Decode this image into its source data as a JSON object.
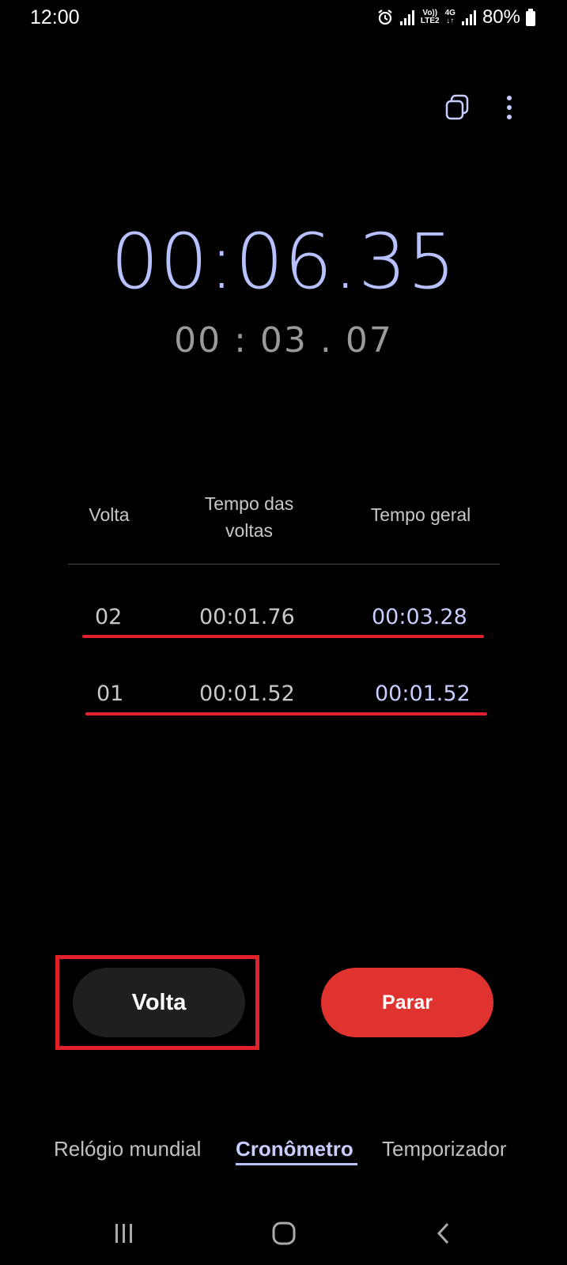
{
  "status_bar": {
    "time": "12:00",
    "network_label_top": "Vo))",
    "network_label_bottom": "LTE2",
    "network_type": "4G",
    "battery": "80%"
  },
  "stopwatch": {
    "total_time": "00:06.35",
    "lap_time": "00 : 03 . 07"
  },
  "lap_table": {
    "headers": {
      "lap": "Volta",
      "lap_time_line1": "Tempo das",
      "lap_time_line2": "voltas",
      "total": "Tempo geral"
    },
    "rows": [
      {
        "lap": "02",
        "lap_time": "00:01.76",
        "total": "00:03.28"
      },
      {
        "lap": "01",
        "lap_time": "00:01.52",
        "total": "00:01.52"
      }
    ]
  },
  "buttons": {
    "lap_label": "Volta",
    "stop_label": "Parar"
  },
  "tabs": {
    "world_clock": "Relógio mundial",
    "stopwatch": "Cronômetro",
    "timer": "Temporizador"
  },
  "colors": {
    "accent": "#b7c1ff",
    "stop_button": "#e0322e",
    "annotation_red": "#e0202a"
  },
  "icons": {
    "status": [
      "alarm-icon",
      "signal-icon",
      "battery-icon"
    ],
    "top": [
      "picture-in-picture-icon",
      "more-options-icon"
    ],
    "nav": [
      "recents-icon",
      "home-icon",
      "back-icon"
    ]
  }
}
